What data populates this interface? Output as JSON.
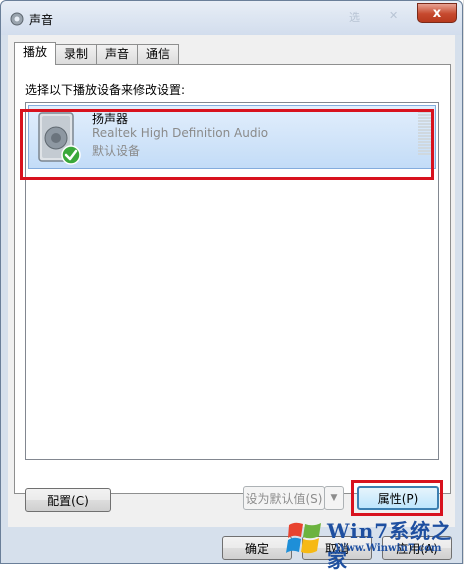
{
  "window": {
    "title": "声音",
    "icon": "speaker-gear-icon",
    "close_label": "x",
    "faded_controls": [
      "选",
      "✕"
    ]
  },
  "tabs": [
    {
      "label": "播放",
      "active": true
    },
    {
      "label": "录制",
      "active": false
    },
    {
      "label": "声音",
      "active": false
    },
    {
      "label": "通信",
      "active": false
    }
  ],
  "playback": {
    "instruction": "选择以下播放设备来修改设置:",
    "devices": [
      {
        "name": "扬声器",
        "driver": "Realtek High Definition Audio",
        "status": "默认设备",
        "icon": "speaker-icon",
        "status_icon": "green-check-icon",
        "level": 0
      }
    ]
  },
  "buttons": {
    "configure": "配置(C)",
    "set_default": "设为默认值(S)",
    "properties": "属性(P)",
    "ok": "确定",
    "cancel": "取消",
    "apply": "应用(A)"
  },
  "watermark": {
    "brand": "Win7系统之家",
    "url": "Www.Winwin7.com"
  },
  "colors": {
    "highlight_red": "#d8121e",
    "selection_blue": "#c3dcf7",
    "check_green": "#3aa83a"
  }
}
